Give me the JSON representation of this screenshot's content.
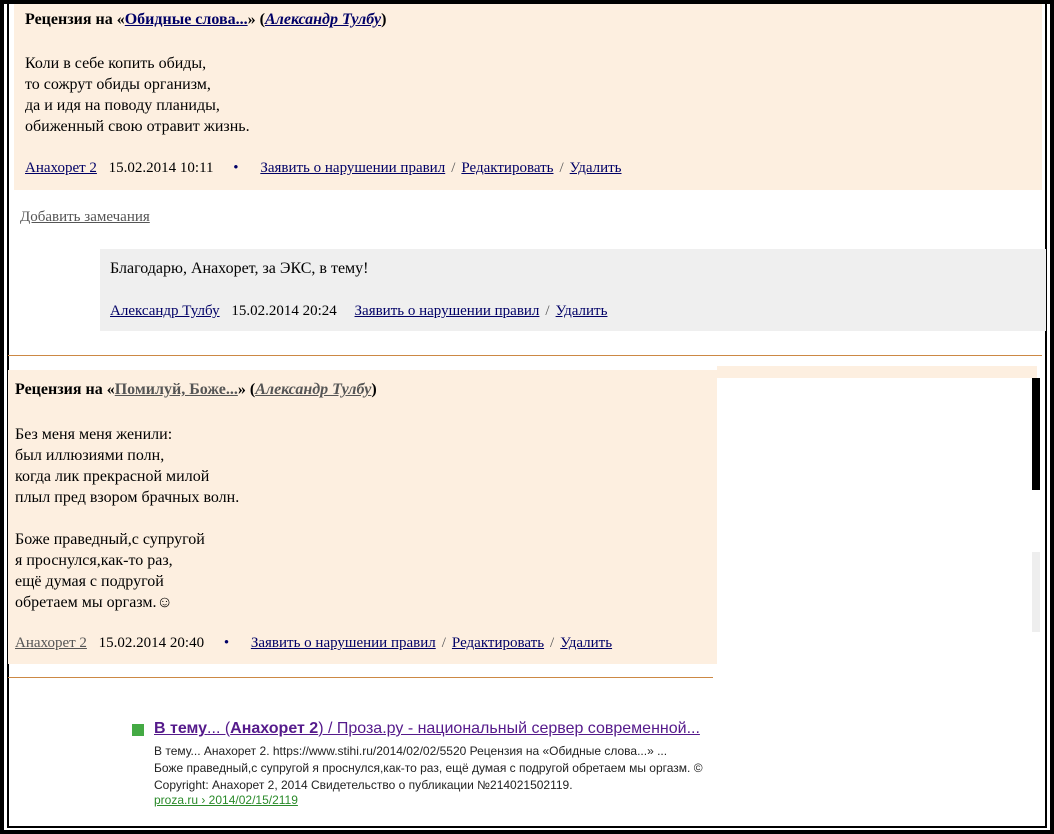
{
  "review1": {
    "prefix": "Рецензия на «",
    "work": "Обидные слова...",
    "middle": "» (",
    "author": "Александр Тулбу",
    "suffix": ")",
    "poem": "Коли в себе копить обиды,\nто сожрут обиды организм,\nда и идя на поводу планиды,\nобиженный свою отравит жизнь.",
    "user": "Анахорет 2",
    "datetime": "15.02.2014 10:11",
    "bullet": "•",
    "report": "Заявить о нарушении правил",
    "edit": "Редактировать",
    "delete": "Удалить",
    "slash": "/"
  },
  "add_remarks": "Добавить замечания",
  "reply": {
    "text": "Благодарю, Анахорет, за ЭКС, в тему!",
    "user": "Александр Тулбу",
    "datetime": "15.02.2014 20:24",
    "report": "Заявить о нарушении правил",
    "delete": "Удалить",
    "slash": "/"
  },
  "review2": {
    "prefix": "Рецензия на «",
    "work": "Помилуй, Боже...",
    "middle": "» (",
    "author": "Александр Тулбу",
    "suffix": ")",
    "poem": "Без меня меня женили:\nбыл иллюзиями полн,\nкогда лик прекрасной милой\nплыл пред взором брачных волн.\n\nБоже праведный,с супругой\nя проснулся,как-то раз,\nещё думая с подругой\nобретаем мы оргазм.☺",
    "user": "Анахорет 2",
    "datetime": "15.02.2014 20:40",
    "bullet": "•",
    "report": "Заявить о нарушении правил",
    "edit": "Редактировать",
    "delete": "Удалить",
    "slash": "/"
  },
  "search_result": {
    "title_bold": "В тему",
    "title_rest1": "... (",
    "title_bold2": "Анахорет 2",
    "title_rest2": ") / Проза.ру - национальный сервер современной...",
    "snippet": "В тему... Анахорет 2. https://www.stihi.ru/2014/02/02/5520 Рецензия на «Обидные слова...» ...\nБоже праведный,с супругой я проснулся,как-то раз, ещё думая с подругой обретаем мы оргазм. ©\nCopyright: Анахорет 2, 2014 Свидетельство о публикации №214021502119.",
    "url": "proza.ru › 2014/02/15/2119",
    "colors": {
      "title": "#551a8b",
      "url": "#2a8a2a",
      "marker": "#44aa44"
    }
  },
  "colors": {
    "review_bg": "#fdefe0",
    "reply_bg": "#efefef",
    "link": "#000066",
    "divider": "#cc8844"
  }
}
